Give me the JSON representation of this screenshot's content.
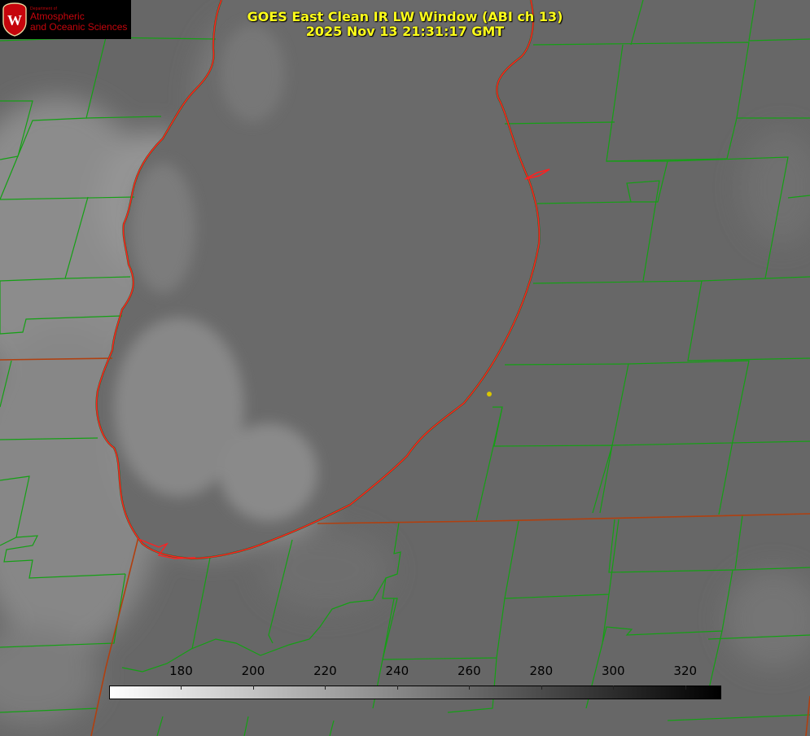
{
  "title": {
    "line1": "GOES East Clean IR LW Window (ABI ch 13)",
    "line2": "2025 Nov 13 21:31:17 GMT"
  },
  "logo": {
    "shield_letter": "W",
    "department": "Department of",
    "line1": "Atmospheric",
    "line2": "and Oceanic Sciences",
    "color": "#c5050c"
  },
  "colorbar": {
    "min": 160,
    "max": 330,
    "ticks": [
      "180",
      "200",
      "220",
      "240",
      "260",
      "280",
      "300",
      "320"
    ],
    "tick_values": [
      180,
      200,
      220,
      240,
      260,
      280,
      300,
      320
    ],
    "gradient": [
      "#ffffff",
      "#000000"
    ]
  },
  "map": {
    "lake_color": "#6a6a6a",
    "land_color": "#686868",
    "cloud_color": "#8e8e8e",
    "shoreline_color": "#ff2020",
    "border_color": "#14a014",
    "state_line_color": "#b04010",
    "station_marker_color": "#d9c600"
  },
  "controls": {
    "zoom_level": 1
  }
}
